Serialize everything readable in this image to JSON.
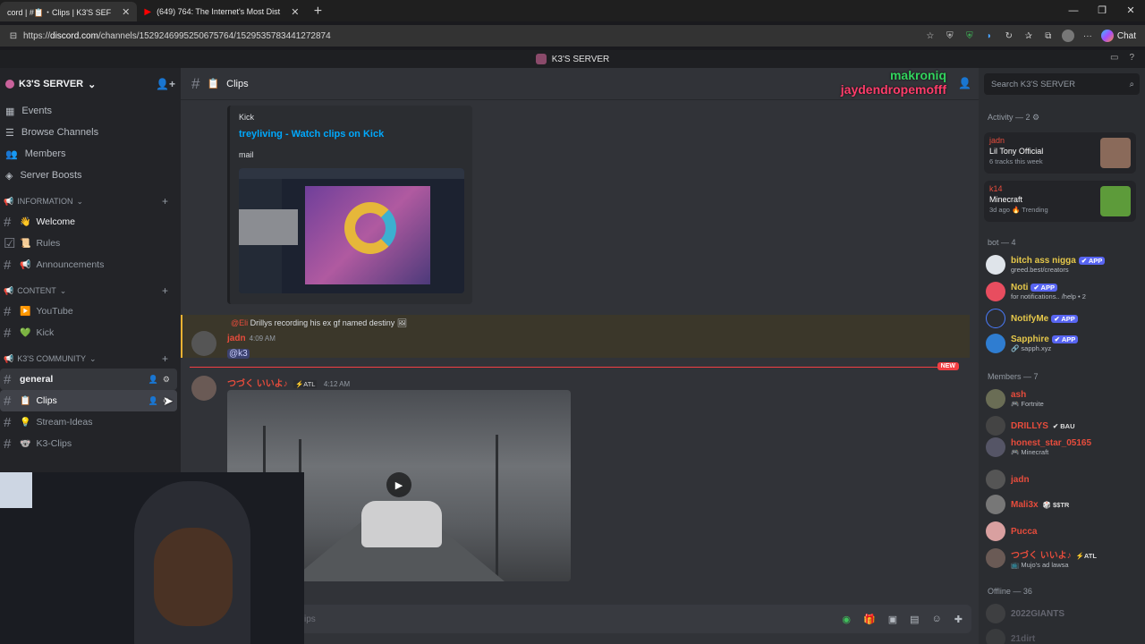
{
  "browser": {
    "tabs": [
      {
        "label": "cord | #📋・Clips | K3'S SEF"
      },
      {
        "label": "(649) 764: The Internet's Most Dist"
      }
    ],
    "url_prefix": "https://",
    "url_domain": "discord.com",
    "url_path": "/channels/1529246995250675764/1529535783441272874",
    "chat_label": "Chat"
  },
  "window": {
    "title": "K3'S SERVER"
  },
  "server": {
    "name": "K3'S SERVER"
  },
  "nav": [
    {
      "label": "Events"
    },
    {
      "label": "Browse Channels"
    },
    {
      "label": "Members"
    },
    {
      "label": "Server Boosts"
    }
  ],
  "categories": {
    "information": "INFORMATION",
    "content": "CONTENT",
    "community": "K3'S COMMUNITY"
  },
  "channels": {
    "welcome": {
      "emoji": "👋",
      "label": "Welcome"
    },
    "rules": {
      "emoji": "📜",
      "label": "Rules"
    },
    "announcements": {
      "emoji": "📢",
      "label": "Announcements"
    },
    "youtube": {
      "emoji": "▶️",
      "label": "YouTube"
    },
    "kick": {
      "emoji": "💚",
      "label": "Kick"
    },
    "general": {
      "label": "general"
    },
    "clips": {
      "emoji": "📋",
      "label": "Clips"
    },
    "stream_ideas": {
      "emoji": "💡",
      "label": "Stream-Ideas"
    },
    "k3_clips": {
      "emoji": "🐨",
      "label": "K3-Clips"
    }
  },
  "chat": {
    "channel_name": "Clips",
    "channel_emoji": "📋",
    "overlay_names": [
      "makroniq",
      "jaydendropemofff"
    ],
    "embed": {
      "provider": "Kick",
      "title": "treyliving - Watch clips on Kick",
      "description": "mail"
    },
    "reply_mention": "@Eli",
    "reply_text": "Drillys recording his ex gf named destiny",
    "msg1": {
      "user": "jadn",
      "time": "4:09 AM",
      "mention": "@k3"
    },
    "new_label": "NEW",
    "msg2": {
      "user": "つづく いいよ♪",
      "tag": "⚡ATL",
      "time": "4:12 AM"
    },
    "input_placeholder": "ips"
  },
  "members": {
    "search_placeholder": "Search K3'S SERVER",
    "activity_header": "Activity — 2",
    "activity": [
      {
        "user": "jadn",
        "title": "Lil Tony Official",
        "sub": "6 tracks this week"
      },
      {
        "user": "k14",
        "title": "Minecraft",
        "sub": "3d ago  🔥 Trending"
      }
    ],
    "bot_header": "bot — 4",
    "bots": [
      {
        "name": "bitch ass nigga",
        "tag": "✔ APP",
        "sub": "greed.best/creators",
        "color": "#e6c84a"
      },
      {
        "name": "Noti",
        "tag": "✔ APP",
        "sub": "for notifications.. /help • 2",
        "color": "#e6c84a"
      },
      {
        "name": "NotifyMe",
        "tag": "✔ APP",
        "sub": "",
        "color": "#e6c84a"
      },
      {
        "name": "Sapphire",
        "tag": "✔ APP",
        "sub": "🔗 sapph.xyz",
        "color": "#e6c84a"
      }
    ],
    "members_header": "Members — 7",
    "people": [
      {
        "name": "ash",
        "tag": "",
        "sub": "🎮 Fortnite",
        "color": "#e74c3c"
      },
      {
        "name": "DRILLYS",
        "tag": "✔ BAU",
        "sub": "",
        "color": "#e74c3c"
      },
      {
        "name": "honest_star_05165",
        "tag": "",
        "sub": "🎮 Minecraft",
        "color": "#e74c3c"
      },
      {
        "name": "jadn",
        "tag": "",
        "sub": "",
        "color": "#e74c3c"
      },
      {
        "name": "Mali3x",
        "tag": "🎲 $$TR",
        "sub": "",
        "color": "#e74c3c"
      },
      {
        "name": "Pucca",
        "tag": "",
        "sub": "",
        "color": "#e74c3c"
      },
      {
        "name": "つづく いいよ♪",
        "tag": "⚡ATL",
        "sub": "📺 Mujo's ad lawsa",
        "color": "#e74c3c"
      }
    ],
    "offline_header": "Offline — 36",
    "offline": [
      {
        "name": "2022GIANTS"
      },
      {
        "name": "21dirt"
      }
    ]
  }
}
